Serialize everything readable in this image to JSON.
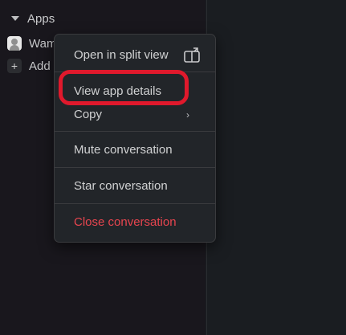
{
  "sidebar": {
    "section_title": "Apps",
    "app_name": "Wam",
    "add_label": "Add"
  },
  "menu": {
    "items": [
      {
        "label": "Open in split view",
        "icon": "split-view-icon"
      },
      {
        "label": "View app details"
      },
      {
        "label": "Copy",
        "icon": "chevron-right-icon",
        "chevron": "›"
      },
      {
        "label": "Mute conversation"
      },
      {
        "label": "Star conversation"
      },
      {
        "label": "Close conversation"
      }
    ]
  },
  "colors": {
    "sidebar_bg": "#19171d",
    "menu_bg": "#222529",
    "danger": "#e8454f",
    "highlight": "#e0192c"
  }
}
